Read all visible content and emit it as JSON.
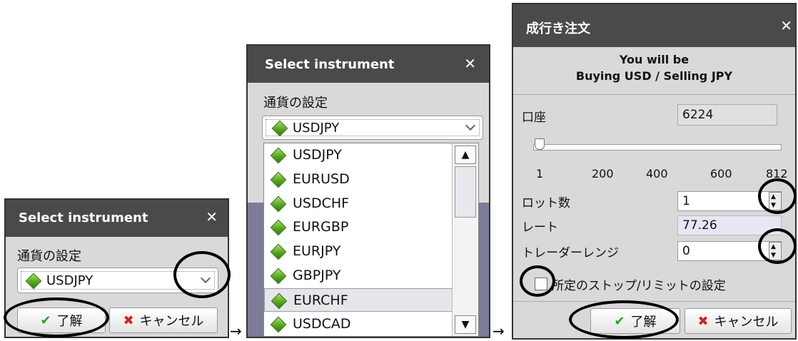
{
  "panel1": {
    "title": "Select instrument",
    "close": "✕",
    "label": "通貨の設定",
    "selected": "USDJPY",
    "ok_label": "了解",
    "cancel_label": "キャンセル"
  },
  "panel2": {
    "title": "Select instrument",
    "close": "✕",
    "label": "通貨の設定",
    "selected": "USDJPY",
    "options": [
      "USDJPY",
      "EURUSD",
      "USDCHF",
      "EURGBP",
      "EURJPY",
      "GBPJPY",
      "EURCHF",
      "USDCAD"
    ],
    "highlighted_option": "EURCHF"
  },
  "panel3": {
    "title": "成行き注文",
    "close": "✕",
    "message_line1": "You will be",
    "message_line2": "Buying USD / Selling JPY",
    "account_label": "口座",
    "account_value": "6224",
    "slider_ticks": [
      "1",
      "200",
      "400",
      "600",
      "812"
    ],
    "slider_value": 1,
    "slider_min": 1,
    "slider_max": 812,
    "lots_label": "ロット数",
    "lots_value": "1",
    "rate_label": "レート",
    "rate_value": "77.26",
    "range_label": "トレーダーレンジ",
    "range_value": "0",
    "stoplimit_label": "所定のストップ/リミットの設定",
    "stoplimit_checked": false,
    "ok_label": "了解",
    "cancel_label": "キャンセル"
  },
  "arrows": [
    "→",
    "→"
  ],
  "icons": {
    "ok": "check-icon",
    "cancel": "x-icon",
    "instrument": "green-diamond-icon"
  },
  "colors": {
    "titlebar": "#4a4a4a",
    "panel": "#d9d9d9",
    "accent_green": "#2aa32a",
    "accent_red": "#d42020",
    "highlight": "#e6e6f5"
  }
}
